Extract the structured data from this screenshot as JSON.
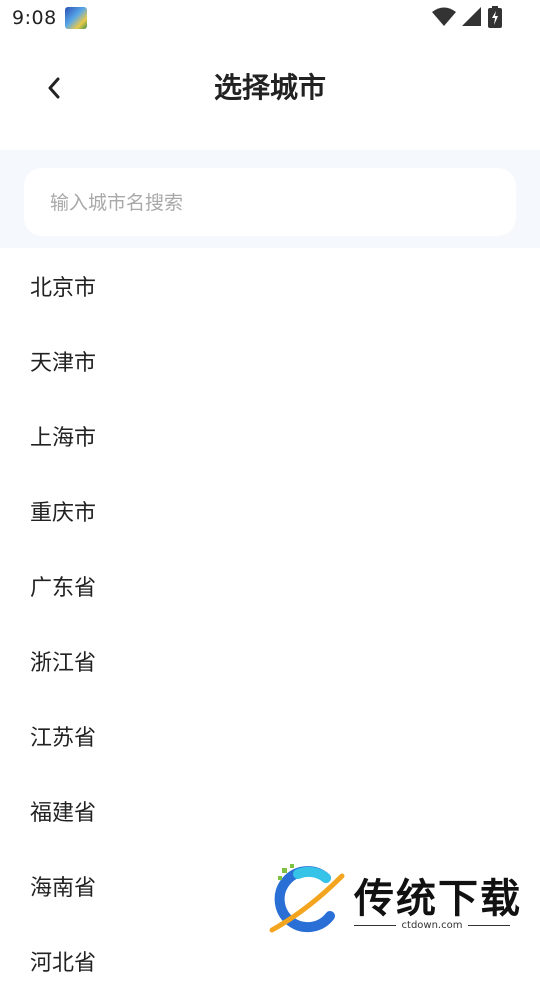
{
  "status_bar": {
    "time": "9:08",
    "icons": [
      "app-thumbnail-icon",
      "wifi-icon",
      "signal-icon",
      "battery-icon"
    ]
  },
  "header": {
    "back_icon": "chevron-left-icon",
    "title": "选择城市"
  },
  "search": {
    "placeholder": "输入城市名搜索",
    "value": ""
  },
  "cities": [
    "北京市",
    "天津市",
    "上海市",
    "重庆市",
    "广东省",
    "浙江省",
    "江苏省",
    "福建省",
    "海南省",
    "河北省"
  ],
  "watermark": {
    "brand": "传统下载",
    "url": "ctdown.com"
  },
  "colors": {
    "search_area_bg": "#f5f8fc",
    "text_primary": "#222222",
    "placeholder": "#a9a9a9"
  }
}
